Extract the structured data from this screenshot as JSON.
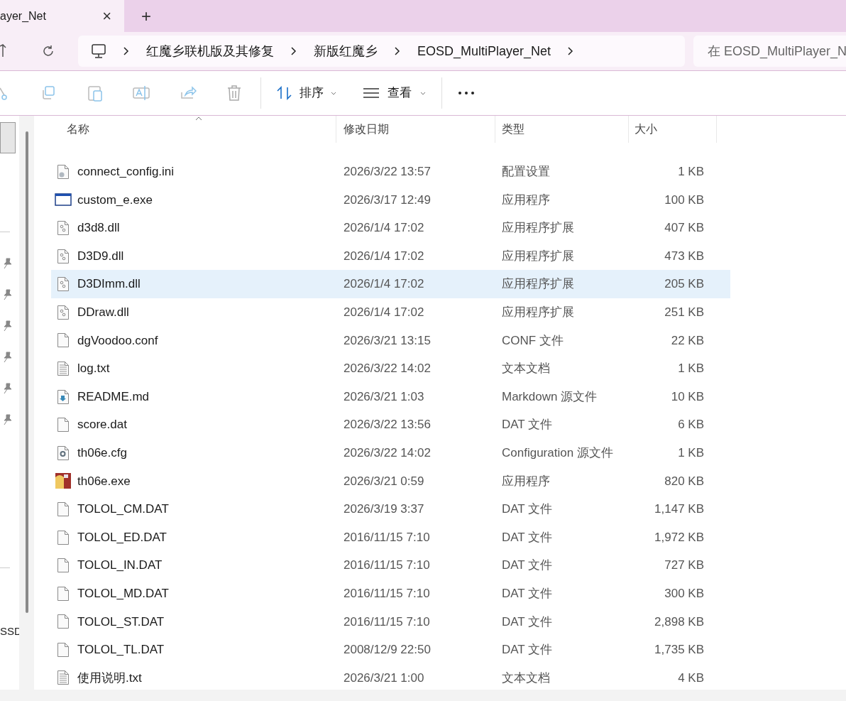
{
  "tab": {
    "title": "ayer_Net",
    "close": "×",
    "new_tab": "+"
  },
  "address": {
    "crumbs": [
      "红魔乡联机版及其修复",
      "新版红魔乡",
      "EOSD_MultiPlayer_Net"
    ],
    "search_placeholder": "在 EOSD_MultiPlayer_N"
  },
  "toolbar": {
    "sort": "排序",
    "view": "查看"
  },
  "sidebar": {
    "items": [
      {
        "label": "SSD"
      }
    ]
  },
  "columns": [
    "名称",
    "修改日期",
    "类型",
    "大小"
  ],
  "rows": [
    {
      "kind": "settings",
      "name": "connect_config.ini",
      "date": "2026/3/22 13:57",
      "type": "配置设置",
      "size": "1 KB",
      "selected": false
    },
    {
      "kind": "app",
      "name": "custom_e.exe",
      "date": "2026/3/17 12:49",
      "type": "应用程序",
      "size": "100 KB",
      "selected": false
    },
    {
      "kind": "dll",
      "name": "d3d8.dll",
      "date": "2026/1/4 17:02",
      "type": "应用程序扩展",
      "size": "407 KB",
      "selected": false
    },
    {
      "kind": "dll",
      "name": "D3D9.dll",
      "date": "2026/1/4 17:02",
      "type": "应用程序扩展",
      "size": "473 KB",
      "selected": false
    },
    {
      "kind": "dll",
      "name": "D3DImm.dll",
      "date": "2026/1/4 17:02",
      "type": "应用程序扩展",
      "size": "205 KB",
      "selected": true
    },
    {
      "kind": "dll",
      "name": "DDraw.dll",
      "date": "2026/1/4 17:02",
      "type": "应用程序扩展",
      "size": "251 KB",
      "selected": false
    },
    {
      "kind": "file",
      "name": "dgVoodoo.conf",
      "date": "2026/3/21 13:15",
      "type": "CONF 文件",
      "size": "22 KB",
      "selected": false
    },
    {
      "kind": "text",
      "name": "log.txt",
      "date": "2026/3/22 14:02",
      "type": "文本文档",
      "size": "1 KB",
      "selected": false
    },
    {
      "kind": "markdown",
      "name": "README.md",
      "date": "2026/3/21 1:03",
      "type": "Markdown 源文件",
      "size": "10 KB",
      "selected": false
    },
    {
      "kind": "file",
      "name": "score.dat",
      "date": "2026/3/22 13:56",
      "type": "DAT 文件",
      "size": "6 KB",
      "selected": false
    },
    {
      "kind": "config",
      "name": "th06e.cfg",
      "date": "2026/3/22 14:02",
      "type": "Configuration 源文件",
      "size": "1 KB",
      "selected": false
    },
    {
      "kind": "game",
      "name": "th06e.exe",
      "date": "2026/3/21 0:59",
      "type": "应用程序",
      "size": "820 KB",
      "selected": false
    },
    {
      "kind": "file",
      "name": "TOLOL_CM.DAT",
      "date": "2026/3/19 3:37",
      "type": "DAT 文件",
      "size": "1,147 KB",
      "selected": false
    },
    {
      "kind": "file",
      "name": "TOLOL_ED.DAT",
      "date": "2016/11/15 7:10",
      "type": "DAT 文件",
      "size": "1,972 KB",
      "selected": false
    },
    {
      "kind": "file",
      "name": "TOLOL_IN.DAT",
      "date": "2016/11/15 7:10",
      "type": "DAT 文件",
      "size": "727 KB",
      "selected": false
    },
    {
      "kind": "file",
      "name": "TOLOL_MD.DAT",
      "date": "2016/11/15 7:10",
      "type": "DAT 文件",
      "size": "300 KB",
      "selected": false
    },
    {
      "kind": "file",
      "name": "TOLOL_ST.DAT",
      "date": "2016/11/15 7:10",
      "type": "DAT 文件",
      "size": "2,898 KB",
      "selected": false
    },
    {
      "kind": "file",
      "name": "TOLOL_TL.DAT",
      "date": "2008/12/9 22:50",
      "type": "DAT 文件",
      "size": "1,735 KB",
      "selected": false
    },
    {
      "kind": "text",
      "name": "使用说明.txt",
      "date": "2026/3/21 1:00",
      "type": "文本文档",
      "size": "4 KB",
      "selected": false
    }
  ]
}
